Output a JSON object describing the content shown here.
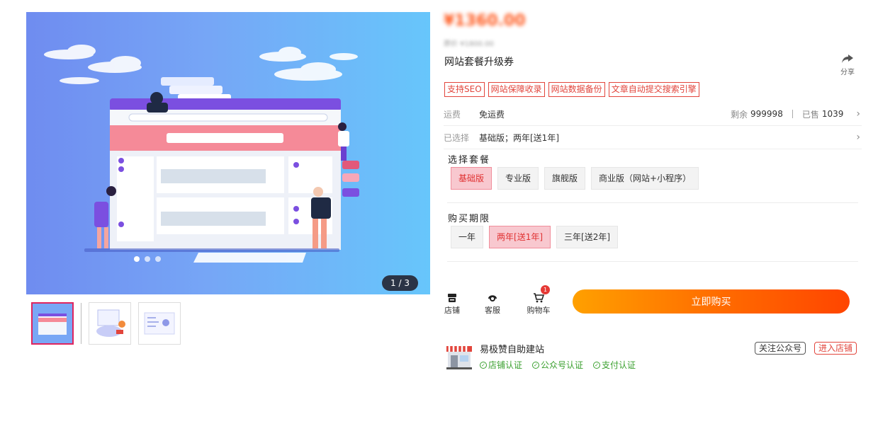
{
  "gallery": {
    "counter": "1 / 3",
    "thumbnails": [
      "thumbnail-1",
      "thumbnail-2",
      "thumbnail-3"
    ],
    "active_index": 0
  },
  "product": {
    "price": "¥1360.00",
    "original_price": "原价 ¥1800.00",
    "title": "网站套餐升级券",
    "share_label": "分享",
    "tags": [
      "支持SEO",
      "网站保障收录",
      "网站数据备份",
      "文章自动提交搜索引擎"
    ]
  },
  "shipping": {
    "label": "运费",
    "value": "免运费",
    "stock_label": "剩余",
    "stock": "999998",
    "sold_label": "已售",
    "sold": "1039"
  },
  "selected": {
    "label": "已选择",
    "value": "基础版；两年[送1年]"
  },
  "package": {
    "title": "选择套餐",
    "options": [
      "基础版",
      "专业版",
      "旗舰版",
      "商业版（网站+小程序）"
    ],
    "selected_index": 0
  },
  "period": {
    "title": "购买期限",
    "options": [
      "一年",
      "两年[送1年]",
      "三年[送2年]"
    ],
    "selected_index": 1
  },
  "actions": {
    "store_label": "店铺",
    "service_label": "客服",
    "cart_label": "购物车",
    "cart_count": "1",
    "buy_label": "立即购买"
  },
  "store": {
    "name": "易极赞自助建站",
    "certs": [
      "店铺认证",
      "公众号认证",
      "支付认证"
    ],
    "follow_label": "关注公众号",
    "enter_label": "进入店铺"
  },
  "colors": {
    "accent": "#ff5a1f",
    "tag_red": "#e2453c",
    "selected_bg": "#f8c8cf",
    "cert_green": "#3aa02e"
  }
}
